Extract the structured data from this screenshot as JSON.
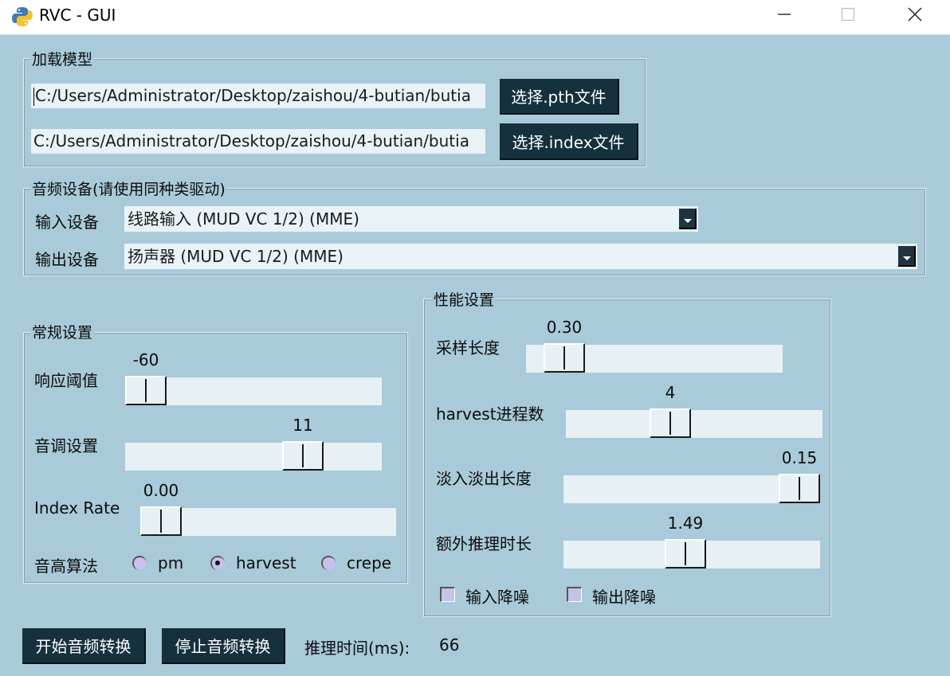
{
  "window": {
    "title": "RVC - GUI"
  },
  "model": {
    "legend": "加载模型",
    "pth_path": "C:/Users/Administrator/Desktop/zaishou/4-butian/butia",
    "pth_button": "选择.pth文件",
    "index_path": "C:/Users/Administrator/Desktop/zaishou/4-butian/butia",
    "index_button": "选择.index文件"
  },
  "audio": {
    "legend": "音频设备(请使用同种类驱动)",
    "input_label": "输入设备",
    "input_value": "线路输入 (MUD VC 1/2) (MME)",
    "output_label": "输出设备",
    "output_value": "扬声器 (MUD VC 1/2) (MME)"
  },
  "general": {
    "legend": "常规设置",
    "threshold": {
      "label": "响应阈值",
      "value": "-60",
      "fraction": 0.0
    },
    "pitch": {
      "label": "音调设置",
      "value": "11",
      "fraction": 0.73
    },
    "index_rate": {
      "label": "Index Rate",
      "value": "0.00",
      "fraction": 0.0
    },
    "f0": {
      "label": "音高算法",
      "options": [
        "pm",
        "harvest",
        "crepe"
      ],
      "selected": "harvest"
    }
  },
  "performance": {
    "legend": "性能设置",
    "block": {
      "label": "采样长度",
      "value": "0.30",
      "fraction": 0.08
    },
    "harvest": {
      "label": "harvest进程数",
      "value": "4",
      "fraction": 0.39
    },
    "crossfade": {
      "label": "淡入淡出长度",
      "value": "0.15",
      "fraction": 1.0
    },
    "extra": {
      "label": "额外推理时长",
      "value": "1.49",
      "fraction": 0.47
    },
    "input_denoise": "输入降噪",
    "output_denoise": "输出降噪"
  },
  "actions": {
    "start": "开始音频转换",
    "stop": "停止音频转换",
    "infer_time_label": "推理时间(ms):",
    "infer_time_value": "66"
  }
}
